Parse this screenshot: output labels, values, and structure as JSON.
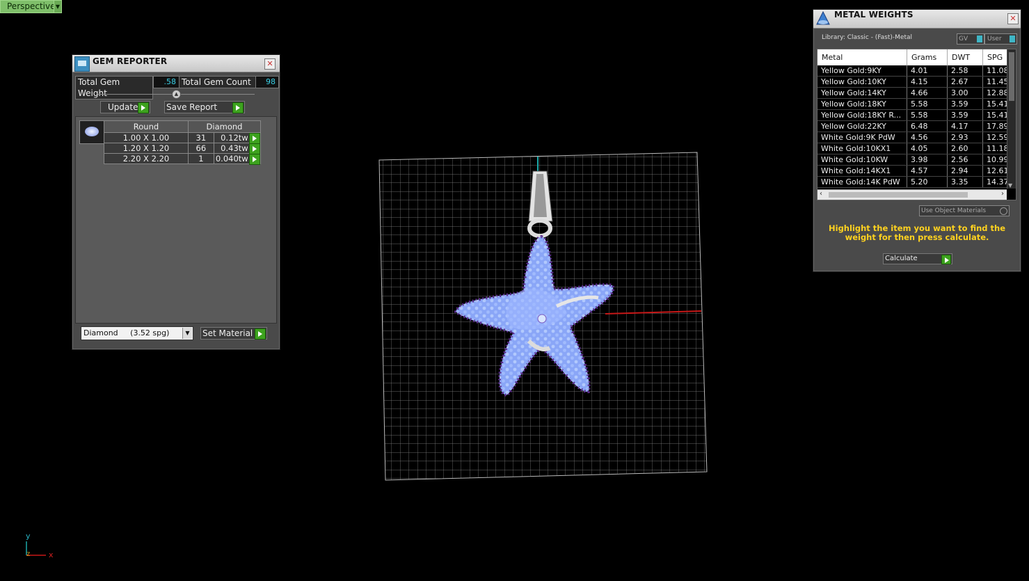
{
  "viewport": {
    "label": "Perspective",
    "axis_y": "y",
    "axis_x": "x",
    "axis_z": "z"
  },
  "gem_reporter": {
    "title": "GEM REPORTER",
    "total_weight_label": "Total Gem Weight",
    "total_weight_value": ".58",
    "total_count_label": "Total Gem Count",
    "total_count_value": "98",
    "update_label": "Update",
    "save_report_label": "Save Report",
    "headers": {
      "shape": "Round",
      "material": "Diamond"
    },
    "rows": [
      {
        "size": "1.00 X 1.00",
        "count": "31",
        "weight": "0.12tw"
      },
      {
        "size": "1.20 X 1.20",
        "count": "66",
        "weight": "0.43tw"
      },
      {
        "size": "2.20 X 2.20",
        "count": "1",
        "weight": "0.040tw"
      }
    ],
    "material_select": "Diamond     (3.52 spg)",
    "set_material_label": "Set Material"
  },
  "metal_weights": {
    "title": "METAL WEIGHTS",
    "library": "Library: Classic - (Fast)-Metal",
    "gv_label": "GV",
    "user_label": "User",
    "columns": [
      "Metal",
      "Grams",
      "DWT",
      "SPG"
    ],
    "rows": [
      [
        "Yellow Gold:9KY",
        "4.01",
        "2.58",
        "11.08"
      ],
      [
        "Yellow Gold:10KY",
        "4.15",
        "2.67",
        "11.45"
      ],
      [
        "Yellow Gold:14KY",
        "4.66",
        "3.00",
        "12.88"
      ],
      [
        "Yellow Gold:18KY",
        "5.58",
        "3.59",
        "15.41"
      ],
      [
        "Yellow Gold:18KY R...",
        "5.58",
        "3.59",
        "15.41"
      ],
      [
        "Yellow Gold:22KY",
        "6.48",
        "4.17",
        "17.89"
      ],
      [
        "White Gold:9K PdW",
        "4.56",
        "2.93",
        "12.59"
      ],
      [
        "White Gold:10KX1",
        "4.05",
        "2.60",
        "11.18"
      ],
      [
        "White Gold:10KW",
        "3.98",
        "2.56",
        "10.99"
      ],
      [
        "White Gold:14KX1",
        "4.57",
        "2.94",
        "12.61"
      ],
      [
        "White Gold:14K PdW",
        "5.20",
        "3.35",
        "14.37"
      ]
    ],
    "use_object_materials": "Use Object Materials",
    "hint": "Highlight the item you want to find the weight for then press calculate.",
    "calculate_label": "Calculate",
    "hint_color": "#ffd21f"
  }
}
